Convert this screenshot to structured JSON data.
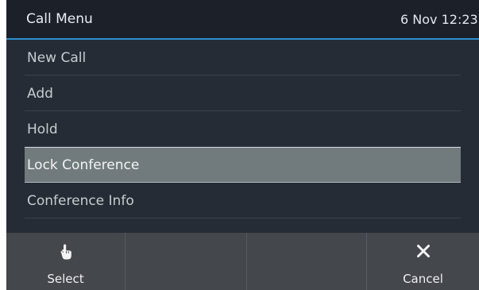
{
  "header": {
    "title": "Call Menu",
    "clock": "6 Nov 12:23"
  },
  "menu": {
    "items": [
      {
        "label": "New Call"
      },
      {
        "label": "Add"
      },
      {
        "label": "Hold"
      },
      {
        "label": "Lock Conference",
        "selected": true
      },
      {
        "label": "Conference Info"
      }
    ]
  },
  "softkeys": {
    "select": {
      "label": "Select",
      "icon": "hand-pointer-icon"
    },
    "cancel": {
      "label": "Cancel",
      "icon": "close-icon"
    }
  },
  "colors": {
    "background": "#252c35",
    "header": "#1b2029",
    "accent_line": "#2f8fd0",
    "selected_row": "#717b7e",
    "softkey_bar": "#44474c"
  }
}
